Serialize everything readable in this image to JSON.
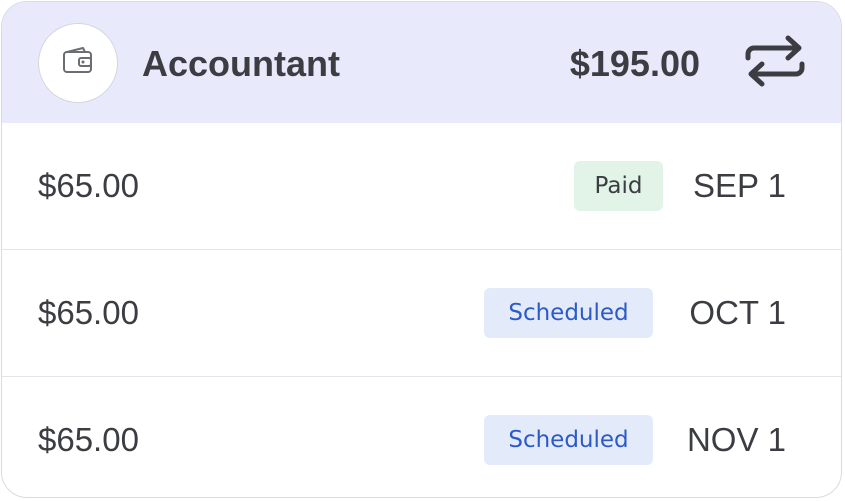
{
  "header": {
    "icon": "wallet-icon",
    "title": "Accountant",
    "total": "$195.00",
    "action_icon": "repeat-icon"
  },
  "payments": [
    {
      "amount": "$65.00",
      "status": "Paid",
      "date": "SEP 1"
    },
    {
      "amount": "$65.00",
      "status": "Scheduled",
      "date": "OCT 1"
    },
    {
      "amount": "$65.00",
      "status": "Scheduled",
      "date": "NOV 1"
    }
  ],
  "colors": {
    "header_bg": "#e8eafc",
    "paid_badge_bg": "#e2f4e7",
    "scheduled_badge_bg": "#e3ebfb",
    "scheduled_text": "#2c5ac9",
    "text": "#3b3d42"
  }
}
